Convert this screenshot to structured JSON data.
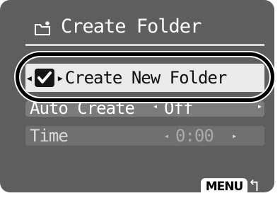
{
  "header": {
    "title": "Create Folder",
    "icon": "new-folder-icon"
  },
  "menu": {
    "create_new_folder": {
      "label": "Create New Folder",
      "checked": true,
      "left_arrow": "◂",
      "right_arrow": "▸"
    },
    "auto_create": {
      "label": "Auto Create",
      "value": "Off",
      "left_arrow": "◂",
      "right_arrow": "▸"
    },
    "time": {
      "label": "Time",
      "value": "0:00",
      "left_arrow": "◂",
      "right_arrow": "▸"
    }
  },
  "footer": {
    "menu_label": "MENU",
    "back_icon": "↰"
  },
  "colors": {
    "screen_bg": "#5e5e5e",
    "selected_bg": "#eaeaea",
    "highlight_ring": "#000000"
  }
}
